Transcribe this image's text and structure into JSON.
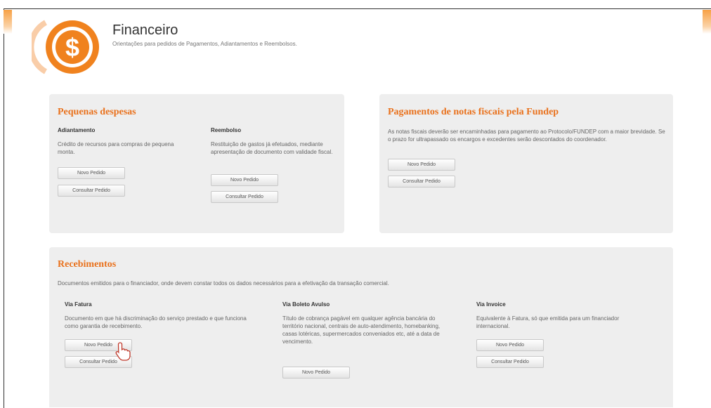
{
  "header": {
    "title": "Financeiro",
    "subtitle": "Orientações para pedidos de Pagamentos, Adiantamentos e Reembolsos.",
    "logo_icon": "dollar-coin-icon"
  },
  "colors": {
    "accent": "#e9711c",
    "panel": "#eeeeee"
  },
  "pequenas": {
    "title": "Pequenas despesas",
    "adiantamento": {
      "heading": "Adiantamento",
      "text": "Crédito de recursos para compras de pequena monta.",
      "new_label": "Novo Pedido",
      "query_label": "Consultar Pedido"
    },
    "reembolso": {
      "heading": "Reembolso",
      "text": "Restituição de gastos já efetuados, mediante apresentação de documento com validade fiscal.",
      "new_label": "Novo Pedido",
      "query_label": "Consultar Pedido"
    }
  },
  "pagamentos": {
    "title": "Pagamentos de notas fiscais pela Fundep",
    "text": "As notas fiscais deverão ser encaminhadas para pagamento ao Protocolo/FUNDEP com a maior brevidade. Se o prazo for ultrapassado os encargos e excedentes serão descontados do coordenador.",
    "new_label": "Novo Pedido",
    "query_label": "Consultar Pedido"
  },
  "recebimentos": {
    "title": "Recebimentos",
    "intro": "Documentos emitidos para o financiador, onde devem constar todos os dados necessários para a efetivação da transação comercial.",
    "fatura": {
      "heading": "Via Fatura",
      "text": "Documento em que há discriminação do serviço prestado e que funciona como garantia de recebimento.",
      "new_label": "Novo Pedido",
      "query_label": "Consultar Pedido"
    },
    "boleto": {
      "heading": "Via Boleto Avulso",
      "text": "Título de cobrança pagável em qualquer agência bancária do território nacional, centrais de auto-atendimento, homebanking, casas lotéricas, supermercados conveniados etc, até a data de vencimento.",
      "new_label": "Novo Pedido"
    },
    "invoice": {
      "heading": "Via Invoice",
      "text": "Equivalente à Fatura, só que emitida para um financiador internacional.",
      "new_label": "Novo Pedido",
      "query_label": "Consultar Pedido"
    }
  }
}
